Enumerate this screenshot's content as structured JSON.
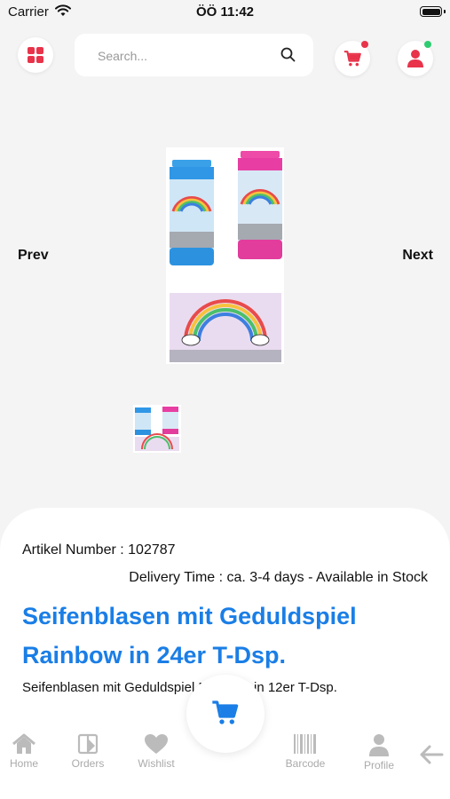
{
  "status_bar": {
    "carrier": "Carrier",
    "time": "ÖÖ 11:42"
  },
  "header": {
    "search_placeholder": "Search...",
    "cart_badge_color": "#e8334a",
    "profile_badge_color": "#2ecc71",
    "accent": "#e8334a"
  },
  "gallery": {
    "prev_label": "Prev",
    "next_label": "Next"
  },
  "product": {
    "artikel": "Artikel Number : 102787",
    "delivery": "Delivery Time : ca. 3-4 days - Available in Stock",
    "title": "Seifenblasen mit Geduldspiel Rainbow in 24er T-Dsp.",
    "description": "Seifenblasen mit Geduldspiel Rainbow in 12er T-Dsp.",
    "title_color": "#1a7ee6"
  },
  "bottom_nav": {
    "home": "Home",
    "orders": "Orders",
    "wishlist": "Wishlist",
    "barcode": "Barcode",
    "profile": "Profile"
  }
}
